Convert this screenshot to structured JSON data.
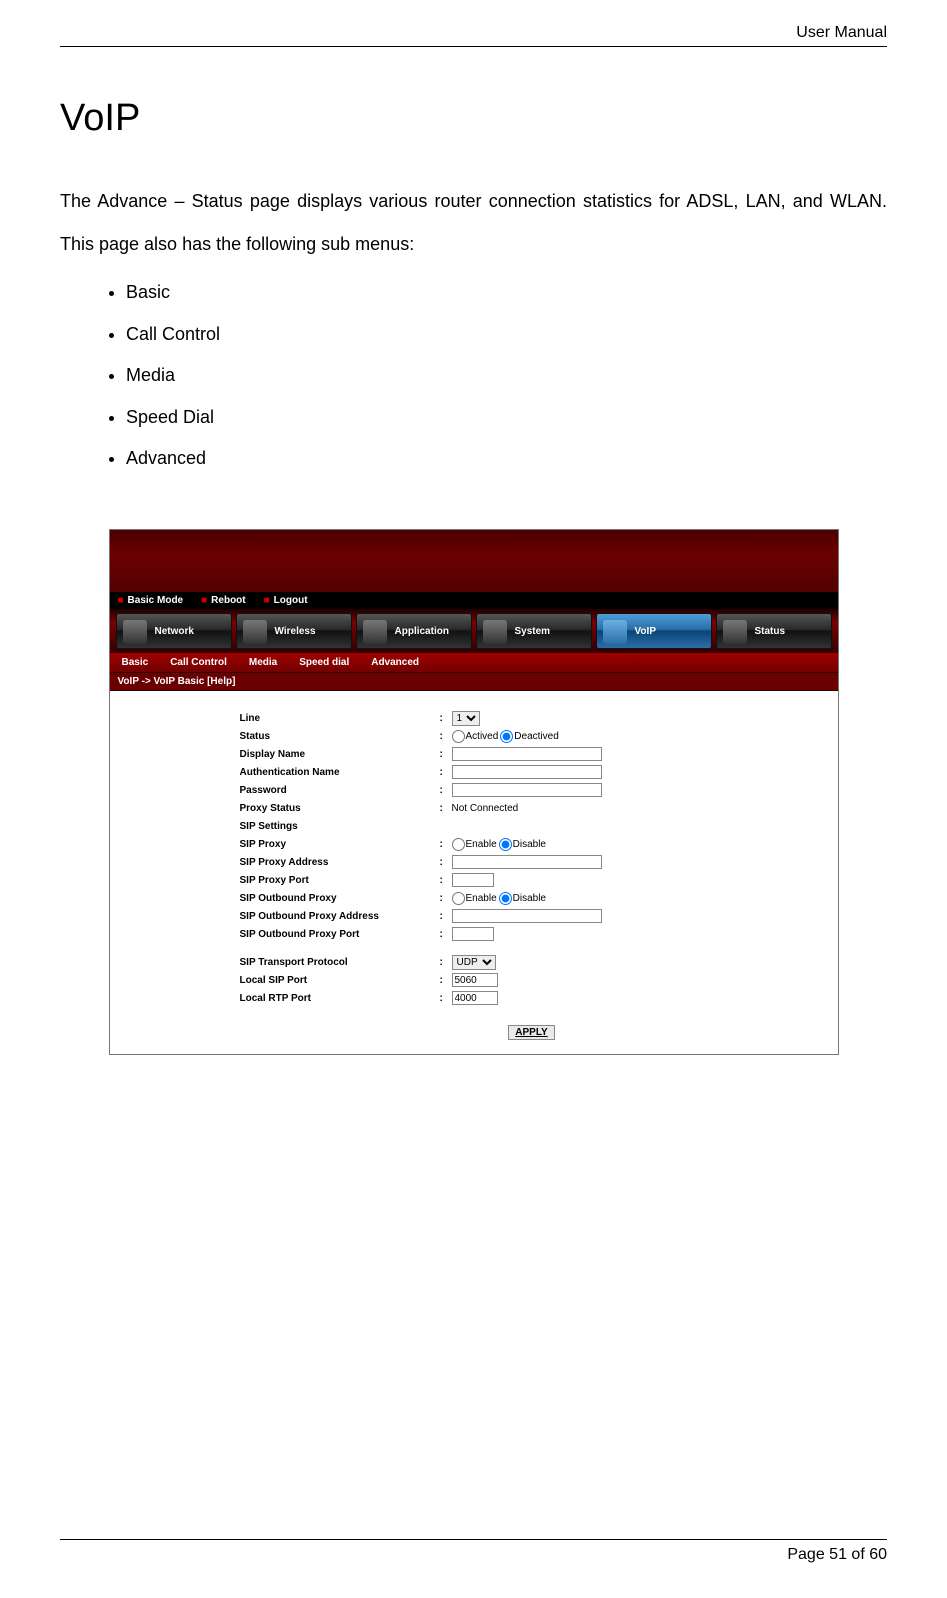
{
  "doc": {
    "header": "User Manual",
    "title": "VoIP",
    "intro": "The Advance – Status page displays various router connection statistics for ADSL, LAN, and WLAN. This page also has the following sub menus:",
    "bullets": [
      "Basic",
      "Call Control",
      "Media",
      "Speed Dial",
      "Advanced"
    ],
    "footer": "Page 51 of 60"
  },
  "screenshot": {
    "modebar": {
      "basic": "Basic Mode",
      "reboot": "Reboot",
      "logout": "Logout"
    },
    "nav": {
      "network": "Network",
      "wireless": "Wireless",
      "application": "Application",
      "system": "System",
      "voip": "VoIP",
      "status": "Status"
    },
    "subnav": {
      "basic": "Basic",
      "call_control": "Call Control",
      "media": "Media",
      "speed_dial": "Speed dial",
      "advanced": "Advanced"
    },
    "breadcrumb": "VoIP -> VoIP Basic [Help]",
    "form": {
      "line": {
        "label": "Line",
        "value": "1"
      },
      "status": {
        "label": "Status",
        "opt1": "Actived",
        "opt2": "Deactived"
      },
      "display_name": {
        "label": "Display Name",
        "value": ""
      },
      "auth_name": {
        "label": "Authentication Name",
        "value": ""
      },
      "password": {
        "label": "Password",
        "value": ""
      },
      "proxy_status": {
        "label": "Proxy Status",
        "value": "Not Connected"
      },
      "sip_settings_heading": "SIP Settings",
      "sip_proxy": {
        "label": "SIP Proxy",
        "opt1": "Enable",
        "opt2": "Disable"
      },
      "sip_proxy_addr": {
        "label": "SIP Proxy Address",
        "value": ""
      },
      "sip_proxy_port": {
        "label": "SIP Proxy Port",
        "value": ""
      },
      "sip_outbound_proxy": {
        "label": "SIP Outbound Proxy",
        "opt1": "Enable",
        "opt2": "Disable"
      },
      "sip_outbound_addr": {
        "label": "SIP Outbound Proxy Address",
        "value": ""
      },
      "sip_outbound_port": {
        "label": "SIP Outbound Proxy Port",
        "value": ""
      },
      "sip_transport": {
        "label": "SIP Transport Protocol",
        "value": "UDP"
      },
      "local_sip_port": {
        "label": "Local SIP Port",
        "value": "5060"
      },
      "local_rtp_port": {
        "label": "Local RTP Port",
        "value": "4000"
      },
      "apply": "APPLY"
    }
  }
}
